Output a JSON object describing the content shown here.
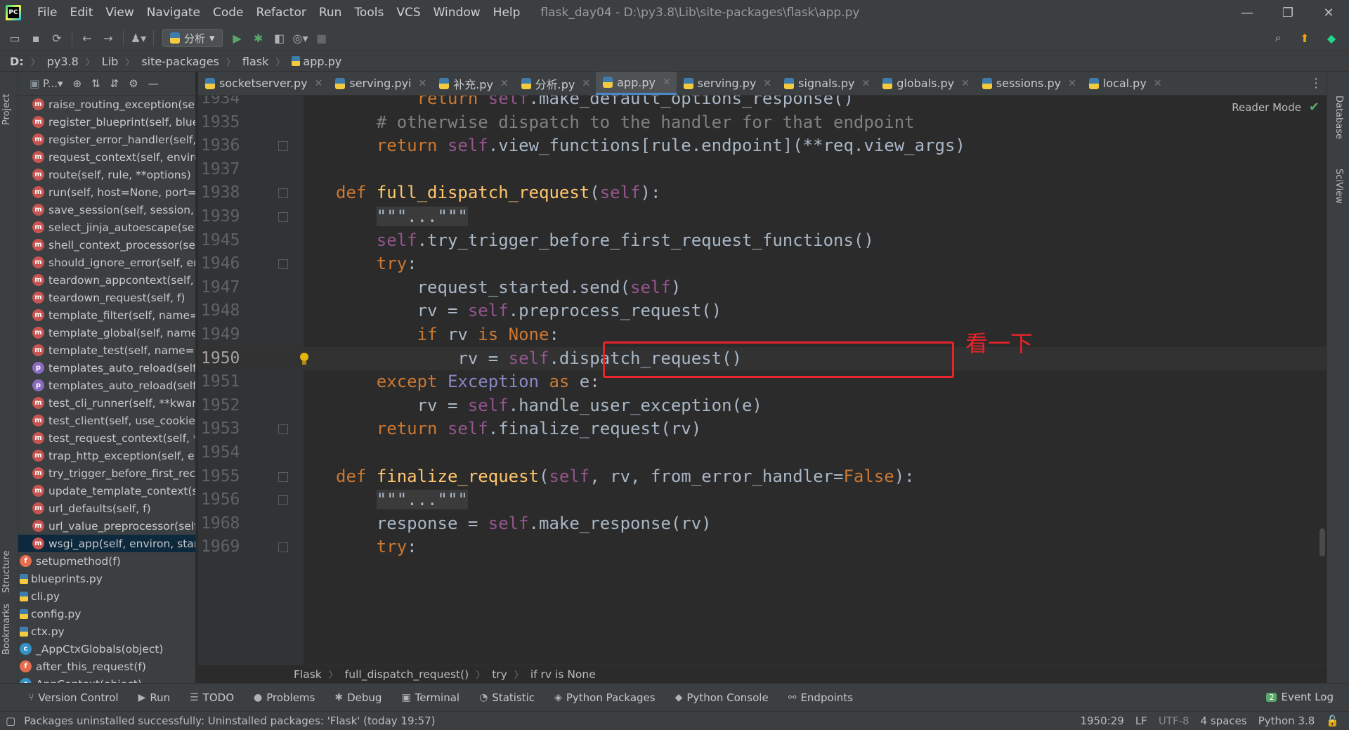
{
  "menubar": {
    "items": [
      "File",
      "Edit",
      "View",
      "Navigate",
      "Code",
      "Refactor",
      "Run",
      "Tools",
      "VCS",
      "Window",
      "Help"
    ],
    "title": "flask_day04 - D:\\py3.8\\Lib\\site-packages\\flask\\app.py"
  },
  "toolbar": {
    "run_config": "分析"
  },
  "breadcrumb": [
    "D:",
    "py3.8",
    "Lib",
    "site-packages",
    "flask",
    "app.py"
  ],
  "left_strip": {
    "project": "Project",
    "structure": "Structure",
    "bookmarks": "Bookmarks"
  },
  "right_strip": {
    "database": "Database",
    "sciview": "SciView"
  },
  "project_panel": {
    "header": "P...",
    "tree": [
      {
        "badge": "m",
        "label": "raise_routing_exception(se",
        "indent": 1
      },
      {
        "badge": "m",
        "label": "register_blueprint(self, blue",
        "indent": 1
      },
      {
        "badge": "m",
        "label": "register_error_handler(self,",
        "indent": 1
      },
      {
        "badge": "m",
        "label": "request_context(self, enviro",
        "indent": 1
      },
      {
        "badge": "m",
        "label": "route(self, rule, **options)",
        "indent": 1
      },
      {
        "badge": "m",
        "label": "run(self, host=None, port=",
        "indent": 1
      },
      {
        "badge": "m",
        "label": "save_session(self, session, r",
        "indent": 1
      },
      {
        "badge": "m",
        "label": "select_jinja_autoescape(self",
        "indent": 1
      },
      {
        "badge": "m",
        "label": "shell_context_processor(se",
        "indent": 1
      },
      {
        "badge": "m",
        "label": "should_ignore_error(self, er",
        "indent": 1
      },
      {
        "badge": "m",
        "label": "teardown_appcontext(self,",
        "indent": 1
      },
      {
        "badge": "m",
        "label": "teardown_request(self, f)",
        "indent": 1
      },
      {
        "badge": "m",
        "label": "template_filter(self, name=",
        "indent": 1
      },
      {
        "badge": "m",
        "label": "template_global(self, name",
        "indent": 1
      },
      {
        "badge": "m",
        "label": "template_test(self, name=N",
        "indent": 1
      },
      {
        "badge": "p",
        "label": "templates_auto_reload(self",
        "indent": 1
      },
      {
        "badge": "p",
        "label": "templates_auto_reload(self",
        "indent": 1
      },
      {
        "badge": "m",
        "label": "test_cli_runner(self, **kwarg",
        "indent": 1
      },
      {
        "badge": "m",
        "label": "test_client(self, use_cookies",
        "indent": 1
      },
      {
        "badge": "m",
        "label": "test_request_context(self, *",
        "indent": 1
      },
      {
        "badge": "m",
        "label": "trap_http_exception(self, e)",
        "indent": 1
      },
      {
        "badge": "m",
        "label": "try_trigger_before_first_rec",
        "indent": 1
      },
      {
        "badge": "m",
        "label": "update_template_context(s",
        "indent": 1
      },
      {
        "badge": "m",
        "label": "url_defaults(self, f)",
        "indent": 1
      },
      {
        "badge": "m",
        "label": "url_value_preprocessor(self",
        "indent": 1
      },
      {
        "badge": "m",
        "label": "wsgi_app(self, environ, star",
        "indent": 1,
        "selected": true
      },
      {
        "badge": "f",
        "label": "setupmethod(f)",
        "indent": 0
      },
      {
        "badge": "file",
        "label": "blueprints.py",
        "indent": -1
      },
      {
        "badge": "file",
        "label": "cli.py",
        "indent": -1
      },
      {
        "badge": "file",
        "label": "config.py",
        "indent": -1
      },
      {
        "badge": "file",
        "label": "ctx.py",
        "indent": -1
      },
      {
        "badge": "c",
        "label": "_AppCtxGlobals(object)",
        "indent": 0
      },
      {
        "badge": "f",
        "label": "after_this_request(f)",
        "indent": 0
      },
      {
        "badge": "c",
        "label": "AppContext(object)",
        "indent": 0
      }
    ]
  },
  "tabs": [
    {
      "label": "socketserver.py",
      "active": false
    },
    {
      "label": "serving.pyi",
      "active": false
    },
    {
      "label": "补充.py",
      "active": false
    },
    {
      "label": "分析.py",
      "active": false
    },
    {
      "label": "app.py",
      "active": true
    },
    {
      "label": "serving.py",
      "active": false
    },
    {
      "label": "signals.py",
      "active": false
    },
    {
      "label": "globals.py",
      "active": false
    },
    {
      "label": "sessions.py",
      "active": false
    },
    {
      "label": "local.py",
      "active": false
    }
  ],
  "editor": {
    "reader_mode": "Reader Mode",
    "annotation": "看一下",
    "current_line": "1950",
    "lines": [
      {
        "n": "1934",
        "html": "        <span class='kw'>return</span> <span class='self'>self</span>.make_default_options_response()"
      },
      {
        "n": "1935",
        "html": "    <span class='cm'># otherwise dispatch to the handler for that endpoint</span>"
      },
      {
        "n": "1936",
        "html": "    <span class='kw'>return</span> <span class='self'>self</span>.view_functions[rule.endpoint](**req.view_args)"
      },
      {
        "n": "1937",
        "html": ""
      },
      {
        "n": "1938",
        "html": "<span class='kw'>def</span> <span class='fn'>full_dispatch_request</span>(<span class='self'>self</span>):"
      },
      {
        "n": "1939",
        "html": "    <span class='fold-box'>\"\"\"...\"\"\"</span>"
      },
      {
        "n": "1945",
        "html": "    <span class='self'>self</span>.try_trigger_before_first_request_functions()"
      },
      {
        "n": "1946",
        "html": "    <span class='kw'>try</span>:"
      },
      {
        "n": "1947",
        "html": "        request_started.send(<span class='self'>self</span>)"
      },
      {
        "n": "1948",
        "html": "        rv = <span class='self'>self</span>.preprocess_request()"
      },
      {
        "n": "1949",
        "html": "        <span class='kw'>if</span> rv <span class='kw'>is</span> <span class='kw'>None</span>:"
      },
      {
        "n": "1950",
        "html": "            rv = <span class='self'>self</span>.dispatch_request()"
      },
      {
        "n": "1951",
        "html": "    <span class='kw'>except</span> <span class='cls'>Exception</span> <span class='kw'>as</span> e:"
      },
      {
        "n": "1952",
        "html": "        rv = <span class='self'>self</span>.handle_user_exception(e)"
      },
      {
        "n": "1953",
        "html": "    <span class='kw'>return</span> <span class='self'>self</span>.finalize_request(rv)"
      },
      {
        "n": "1954",
        "html": ""
      },
      {
        "n": "1955",
        "html": "<span class='kw'>def</span> <span class='fn'>finalize_request</span>(<span class='self'>self</span>, rv, from_error_handler=<span class='kw'>False</span>):"
      },
      {
        "n": "1956",
        "html": "    <span class='fold-box'>\"\"\"...\"\"\"</span>"
      },
      {
        "n": "1968",
        "html": "    response = <span class='self'>self</span>.make_response(rv)"
      },
      {
        "n": "1969",
        "html": "    <span class='kw'>try</span>:"
      }
    ]
  },
  "editor_breadcrumb": [
    "Flask",
    "full_dispatch_request()",
    "try",
    "if rv is None"
  ],
  "toolwindows": [
    {
      "icon": "⑂",
      "label": "Version Control"
    },
    {
      "icon": "▶",
      "label": "Run"
    },
    {
      "icon": "☰",
      "label": "TODO"
    },
    {
      "icon": "●",
      "label": "Problems"
    },
    {
      "icon": "✱",
      "label": "Debug"
    },
    {
      "icon": "▣",
      "label": "Terminal"
    },
    {
      "icon": "◔",
      "label": "Statistic"
    },
    {
      "icon": "◈",
      "label": "Python Packages"
    },
    {
      "icon": "◆",
      "label": "Python Console"
    },
    {
      "icon": "⚯",
      "label": "Endpoints"
    }
  ],
  "event_log": {
    "count": "2",
    "label": "Event Log"
  },
  "status": {
    "message": "Packages uninstalled successfully: Uninstalled packages: 'Flask' (today 19:57)",
    "position": "1950:29",
    "line_sep": "LF",
    "encoding": "UTF-8",
    "indent": "4 spaces",
    "interpreter": "Python 3.8"
  }
}
